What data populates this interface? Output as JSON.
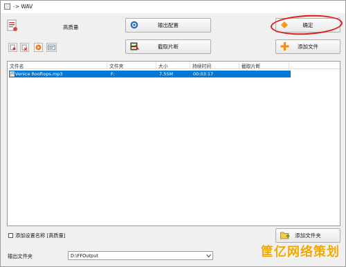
{
  "window": {
    "title": "-> WAV"
  },
  "quality": {
    "label": "高质量"
  },
  "buttons": {
    "output_config": "输出配置",
    "ok": "确定",
    "clip": "截取片断",
    "add_file": "添加文件",
    "add_folder": "添加文件夹"
  },
  "toolbar": {
    "icons": [
      "add-item-icon",
      "delete-icon",
      "play-icon",
      "media-info-icon"
    ]
  },
  "table": {
    "columns": [
      "文件名",
      "文件夹",
      "大小",
      "持续时间",
      "截取片断"
    ],
    "rows": [
      {
        "name": "Venice Rooftops.mp3",
        "folder": "F:",
        "size": "7.55M",
        "duration": "00:03:17",
        "clip": ""
      }
    ]
  },
  "options": {
    "add_setting_name": "添加设置名称 [高质量]",
    "add_setting_checked": false
  },
  "output": {
    "label": "输出文件夹",
    "value": "D:\\FFOutput"
  },
  "annotation": {
    "color": "#e01818"
  },
  "watermark": {
    "text": "筐亿网络策划"
  },
  "colors": {
    "selection": "#0078d7",
    "accent_orange": "#f39a1e"
  }
}
